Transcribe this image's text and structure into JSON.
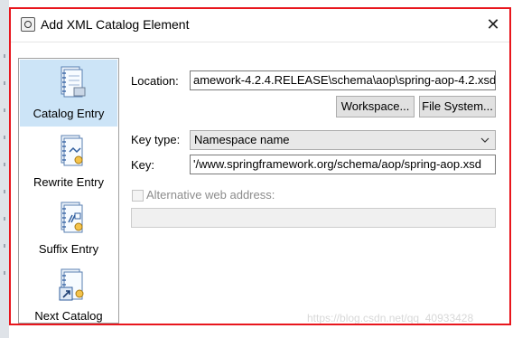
{
  "window": {
    "title": "Add XML Catalog Element",
    "close_glyph": "✕"
  },
  "sidebar": {
    "items": [
      {
        "label": "Catalog Entry",
        "icon": "catalog-entry-icon",
        "selected": true
      },
      {
        "label": "Rewrite Entry",
        "icon": "rewrite-entry-icon",
        "selected": false
      },
      {
        "label": "Suffix Entry",
        "icon": "suffix-entry-icon",
        "selected": false
      },
      {
        "label": "Next Catalog",
        "icon": "next-catalog-icon",
        "selected": false
      }
    ]
  },
  "form": {
    "location_label": "Location:",
    "location_value": "amework-4.2.4.RELEASE\\schema\\aop\\spring-aop-4.2.xsd",
    "workspace_button": "Workspace...",
    "filesystem_button": "File System...",
    "keytype_label": "Key type:",
    "keytype_value": "Namespace name",
    "key_label": "Key:",
    "key_value": "'/www.springframework.org/schema/aop/spring-aop.xsd",
    "alt_web_label": "Alternative web address:",
    "alt_web_value": "",
    "alt_web_checked": false
  },
  "watermark": "https://blog.csdn.net/qq_40933428",
  "colors": {
    "selection": "#cce4f7",
    "frame_highlight": "#e8161d"
  }
}
